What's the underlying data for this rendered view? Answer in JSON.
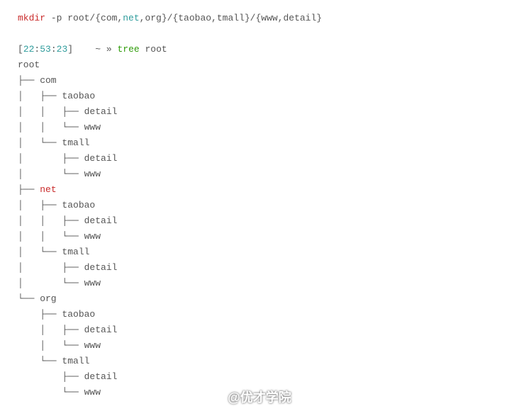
{
  "cmd1": {
    "mkdir": "mkdir",
    "args": " -p root/{com,",
    "net": "net",
    "rest": ",org}/{taobao,tmall}/{www,detail}"
  },
  "prompt": {
    "lb": "[",
    "h": "22",
    "c1": ":",
    "m": "53",
    "c2": ":",
    "s": "23",
    "rb": "]    ~ » ",
    "tree": "tree",
    "arg": " root"
  },
  "tree": {
    "l0": "root",
    "l1": "├── com",
    "l2": "│   ├── taobao",
    "l3": "│   │   ├── detail",
    "l4": "│   │   └── www",
    "l5": "│   └── tmall",
    "l6": "│       ├── detail",
    "l7": "│       └── www",
    "l8p": "├── ",
    "l8t": "net",
    "l9": "│   ├── taobao",
    "l10": "│   │   ├── detail",
    "l11": "│   │   └── www",
    "l12": "│   └── tmall",
    "l13": "│       ├── detail",
    "l14": "│       └── www",
    "l15": "└── org",
    "l16": "    ├── taobao",
    "l17": "    │   ├── detail",
    "l18": "    │   └── www",
    "l19": "    └── tmall",
    "l20": "        ├── detail",
    "l21": "        └── www"
  },
  "watermark": "@优才学院"
}
